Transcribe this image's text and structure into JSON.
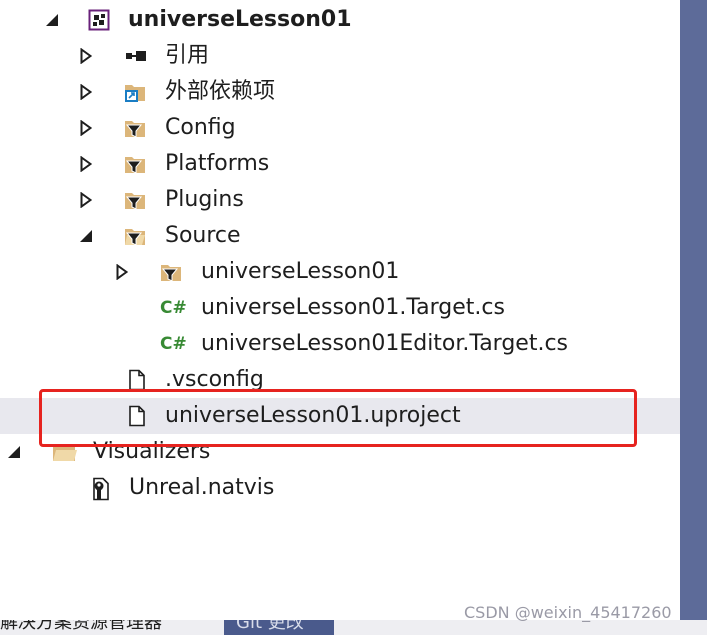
{
  "tree": {
    "project": "universeLesson01",
    "references": "引用",
    "external_deps": "外部依赖项",
    "config": "Config",
    "platforms": "Platforms",
    "plugins": "Plugins",
    "source": "Source",
    "source_folder": "universeLesson01",
    "target_cs": "universeLesson01.Target.cs",
    "editor_target_cs": "universeLesson01Editor.Target.cs",
    "vsconfig": ".vsconfig",
    "uproject": "universeLesson01.uproject",
    "visualizers": "Visualizers",
    "natvis": "Unreal.natvis",
    "csharp_glyph": "C#"
  },
  "bottom": {
    "tab1": "解决方案资源管理器",
    "tab2": "Git 更改"
  },
  "watermark": "CSDN @weixin_45417260",
  "colors": {
    "highlight": "#e6231f",
    "selected_row": "#e8e8ee",
    "folder": "#dcb67a",
    "csharp": "#388a34",
    "vs_purple": "#68217a",
    "side_border": "#5d6b99"
  }
}
